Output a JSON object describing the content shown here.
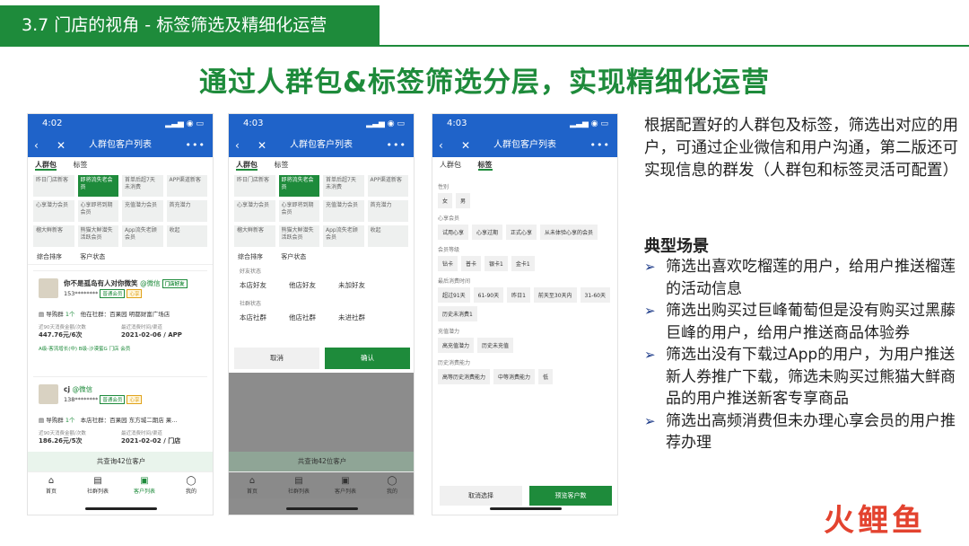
{
  "header": {
    "title": "3.7 门店的视角 - 标签筛选及精细化运营"
  },
  "main_title": "通过人群包&标签筛选分层，实现精细化运营",
  "phone": {
    "nav_title": "人群包客户列表",
    "tab_crowd": "人群包",
    "tab_tags": "标签",
    "sort_label": "综合排序",
    "status_label": "客户状态",
    "footer_total": "共查询42位客户",
    "tabbar": [
      "首页",
      "社群列表",
      "客户列表",
      "我的"
    ]
  },
  "phone1": {
    "time": "4:02",
    "tags": [
      "昨日门店新客",
      "即将流失老会员",
      "首单后超7天未消费",
      "APP渠道新客",
      "心享潜力会员",
      "心享即将到期会员",
      "充值潜力会员",
      "首充潜力",
      "榴大鲜新客",
      "熊猫大鲜潜失活跃会员",
      "App流失老顾会员",
      "收起"
    ],
    "cards": [
      {
        "name": "你不是孤岛有人对你微笑",
        "wx": "@微信",
        "badge1": "门店好友",
        "phone": "153********",
        "badge2": "普通会员",
        "badge3": "心享",
        "group": "导购群",
        "group_count": "1个",
        "store": "他在社群：百果园 明都财富广场店",
        "label_a": "近90天消费金额/次数",
        "label_b": "最近消费时间/渠道",
        "value_a": "447.76元/6次",
        "value_b": "2021-02-06 / APP",
        "tags": "A级-客流增长(中)   B级-沙漠蜜G   门店   会员"
      },
      {
        "name": "cj",
        "wx": "@微信",
        "badge1": "",
        "phone": "138********",
        "badge2": "普通会员",
        "badge3": "心享",
        "group": "导购群",
        "group_count": "1个",
        "store": "本店社群：百果园 东方城二期店 果...",
        "label_a": "近90天消费金额/次数",
        "label_b": "最近消费时间/渠道",
        "value_a": "186.26元/5次",
        "value_b": "2021-02-02 / 门店",
        "tags": ""
      }
    ]
  },
  "phone2": {
    "time": "4:03",
    "group1_title": "好友状态",
    "group1": [
      "本店好友",
      "他店好友",
      "未加好友"
    ],
    "group2_title": "社群状态",
    "group2": [
      "本店社群",
      "他店社群",
      "未进社群"
    ],
    "btn_cancel": "取消",
    "btn_confirm": "确认"
  },
  "phone3": {
    "time": "4:03",
    "sections": [
      {
        "title": "性别",
        "items": [
          "女",
          "男"
        ]
      },
      {
        "title": "心享会员",
        "items": [
          "试用心享",
          "心享过期",
          "正式心享",
          "从未体验心享的会员"
        ]
      },
      {
        "title": "会员等级",
        "items": [
          "钻卡",
          "普卡",
          "银卡1",
          "金卡1"
        ]
      },
      {
        "title": "最后消费时间",
        "items": [
          "超过91天",
          "61-90天",
          "昨日1",
          "前天至30天内",
          "31-60天",
          "历史未消费1"
        ]
      },
      {
        "title": "充值潜力",
        "items": [
          "高充值潜力",
          "历史未充值"
        ]
      },
      {
        "title": "历史消费能力",
        "items": [
          "高等历史消费能力",
          "中等消费能力",
          "低"
        ]
      }
    ],
    "btn_clear": "取消选择",
    "btn_preview": "预览客户数"
  },
  "right_text": "根据配置好的人群包及标签，筛选出对应的用户，可通过企业微信和用户沟通，第二版还可实现信息的群发（人群包和标签灵活可配置）",
  "scenarios_title": "典型场景",
  "scenarios": [
    "筛选出喜欢吃榴莲的用户，给用户推送榴莲的活动信息",
    "筛选出购买过巨峰葡萄但是没有购买过黑藤巨峰的用户，给用户推送商品体验券",
    "筛选出没有下载过App的用户，为用户推送新人券推广下载，筛选未购买过熊猫大鲜商品的用户推送新客专享商品",
    "筛选出高频消费但未办理心享会员的用户推荐办理"
  ],
  "logo": "火鲤鱼",
  "colors": {
    "green": "#1e8b3b",
    "blue": "#1f63c9",
    "logo_red": "#e3432f"
  }
}
